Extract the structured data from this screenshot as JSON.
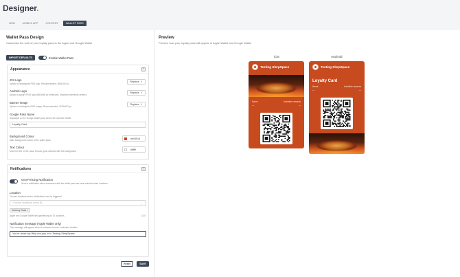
{
  "app": {
    "brand": "Designer",
    "brand_dot": "."
  },
  "tabs": [
    {
      "label": "Web"
    },
    {
      "label": "Mobile App"
    },
    {
      "label": "Content"
    },
    {
      "label": "Wallet Pass",
      "active": true
    }
  ],
  "left": {
    "title": "Wallet Pass Design",
    "subtitle": "Customise the look of your loyalty pass in the Apple and Google Wallet",
    "import_label": "Import Defaults",
    "enable_label": "Enable Wallet Pass",
    "appearance": {
      "title": "Appearance",
      "collapse_glyph": "⌃",
      "fields": [
        {
          "label": "iOS Logo",
          "help": "Upload a rectangular PNG logo. Recommended: 480x150 px",
          "button": "Replace"
        },
        {
          "label": "Android Logo",
          "help": "Upload a square PNG logo (660x660 px minimum). Important elements centred.",
          "button": "Replace"
        },
        {
          "label": "Banner Image",
          "help": "Upload a rectangular PNG image. Recommended: 1125x432 px",
          "button": "Replace"
        }
      ],
      "google_pass_name": {
        "label": "Google Pass Name",
        "help": "Displayed on the Google Wallet pass above the member details",
        "value": "Loyalty Card"
      },
      "background": {
        "label": "Background Colour",
        "help": "Main background colour of the wallet pass",
        "hex": "#e0451b",
        "swatch": "#c84a1f"
      },
      "text": {
        "label": "Text Colour",
        "help": "Used for text on the pass. Ensure good contrast with the background",
        "hex": "#ffffff",
        "swatch": "#ffffff"
      }
    },
    "notifications": {
      "title": "Notifications",
      "collapse_glyph": "⌃",
      "geo_label": "Geo-Fencing Notification",
      "geo_help": "Send a notification when customers with the wallet pass are near selected store locations",
      "location_label": "Location",
      "location_help": "Choose locations where notifications can be triggered",
      "location_placeholder": "Choose locations (max 8)",
      "location_caret": "⌄",
      "chip": "Hackney Road ×",
      "limit_help": "Apple and Google Wallet limit geofencing to 10 locations",
      "count": "1/10",
      "message_label": "Notification message (Apple Wallet only)",
      "message_help": "This message will appear when a customer is near a selected location",
      "message_value": "You're close by! Why not pop in to Testing SlerpSpace"
    },
    "reset_label": "Reset",
    "save_label": "Save"
  },
  "preview": {
    "title": "Preview",
    "subtitle": "Preview how your loyalty pass will appear in Apple Wallet and Google Wallet",
    "ios_label": "iOS",
    "android_label": "Android",
    "pass_title": "Testing SlerpSpace",
    "ios_name_label": "Name",
    "ios_name_value": "—",
    "ios_rewards_label": "Available rewards",
    "ios_rewards_value": "—",
    "android_card_title": "Loyalty Card",
    "android_name_label": "Name",
    "android_name_value": "—",
    "android_rewards_label": "Available rewards",
    "android_rewards_value": "—"
  },
  "colors": {
    "pass_bg": "#c84a1f",
    "accent": "#3c4656",
    "brand_dot": "#e8731a"
  }
}
